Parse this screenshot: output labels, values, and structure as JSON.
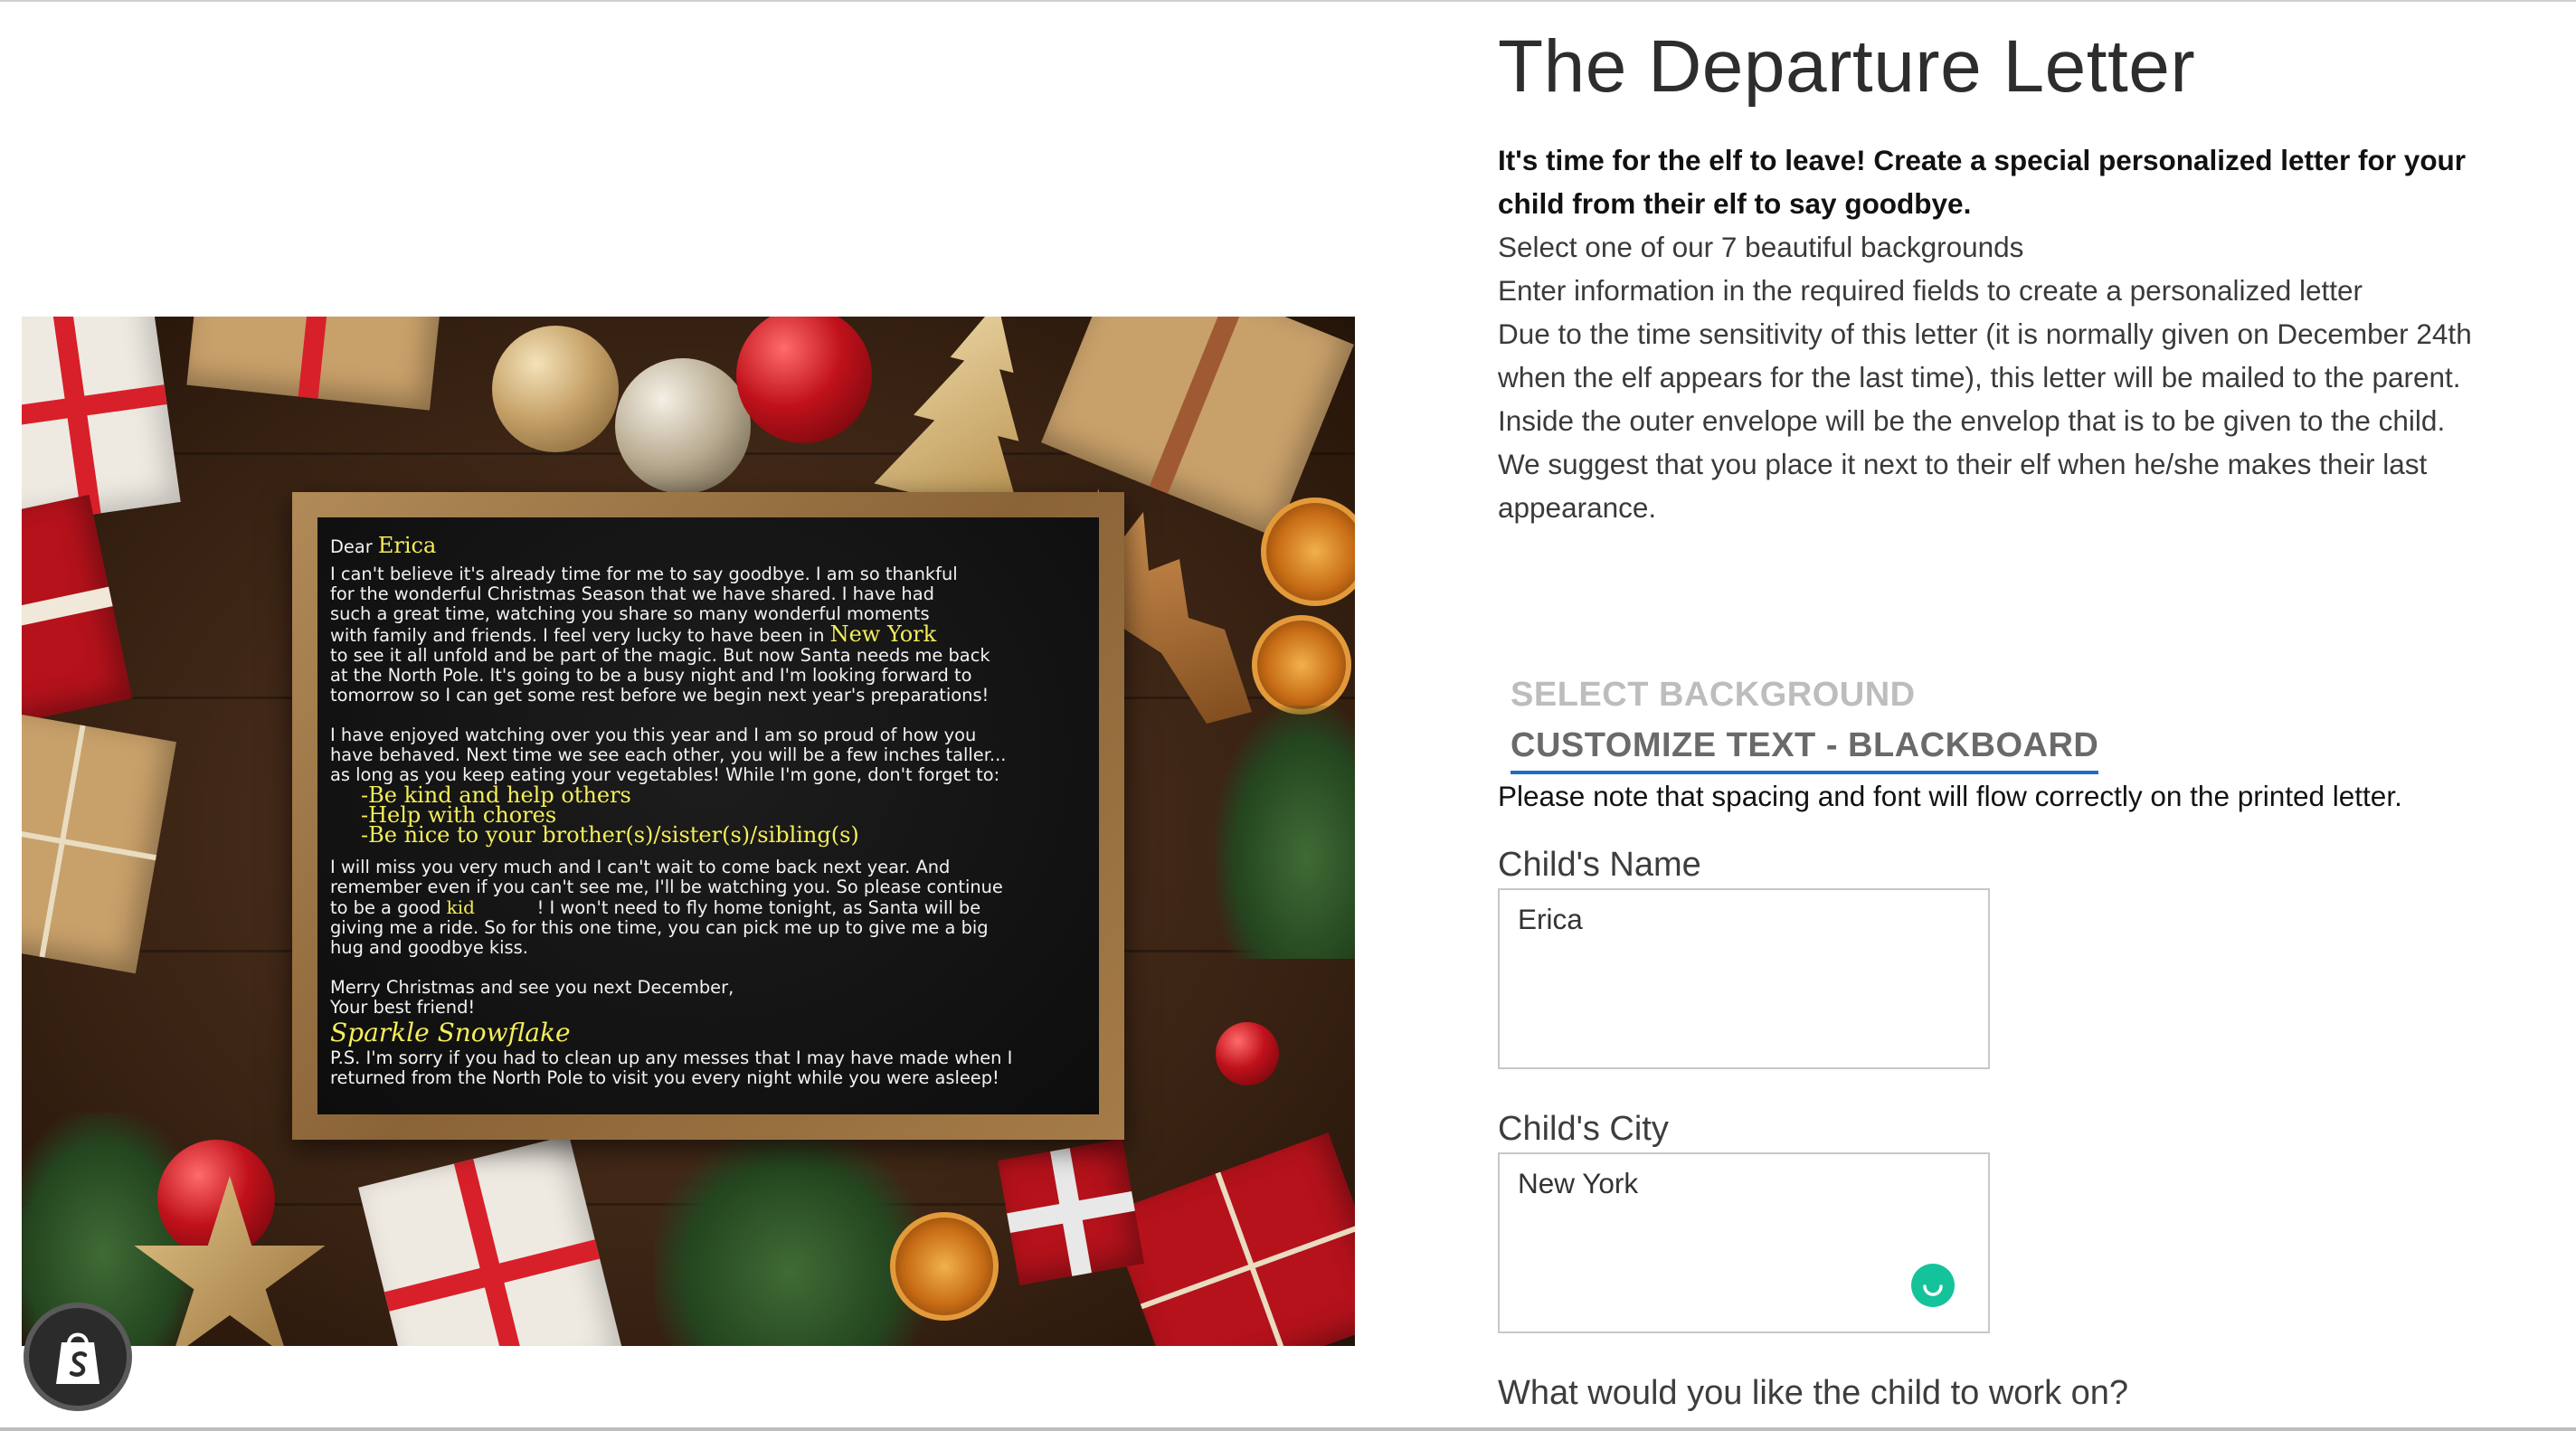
{
  "product": {
    "title": "The Departure Letter",
    "description_lead": "It's time for the elf to leave! Create a special personalized letter for your child from their elf to say goodbye.",
    "description_lines": [
      "Select one of our 7 beautiful backgrounds",
      "Enter information in the required fields to create a personalized letter",
      "Due to the time sensitivity of this letter (it is normally given on December 24th when the elf appears for the last time), this letter will be mailed to the parent. Inside the outer envelope will be the envelop that is to be given to the child. We suggest that you place it next to their elf when he/she makes their last appearance."
    ]
  },
  "tabs": {
    "select_background": "SELECT BACKGROUND",
    "customize_text": "CUSTOMIZE TEXT - BLACKBOARD"
  },
  "note": "Please note that spacing and font will flow correctly on the printed letter.",
  "form": {
    "child_name_label": "Child's Name",
    "child_name_value": "Erica",
    "child_city_label": "Child's City",
    "child_city_value": "New York",
    "work_on_label": "What would you like the child to work on?"
  },
  "letter": {
    "dear": "Dear",
    "name": "Erica",
    "p1_l1": "I can't believe it's already time for me to say goodbye. I am so thankful",
    "p1_l2": "for the wonderful Christmas Season that we have shared. I have had",
    "p1_l3": "such a great time, watching you share so many wonderful moments",
    "p1_l4": "with family and friends. I feel very lucky to have been in",
    "city": "New York",
    "p1_l5": "to see it all unfold and be part of the magic. But now Santa needs me back",
    "p1_l6": "at the North Pole. It's going to be a busy night and I'm looking forward to",
    "p1_l7": "tomorrow so I can get some rest before we begin next year's preparations!",
    "p2_l1": "I have enjoyed watching over you this year and I am so proud of how you",
    "p2_l2": "have behaved. Next time we see each other, you will be a few inches taller...",
    "p2_l3": "as long as you keep eating your vegetables! While I'm gone, don't forget to:",
    "list_1": "-Be kind and help others",
    "list_2": "-Help with chores",
    "list_3": "-Be nice to your brother(s)/sister(s)/sibling(s)",
    "p3_l1": "I will miss you very much and I can't wait to come back next year. And",
    "p3_l2": "remember even if you can't see me, I'll be watching you. So please continue",
    "p3_l3a": "to be a good",
    "kid": "kid",
    "p3_l3b": "! I won't need to fly home tonight, as Santa will be",
    "p3_l4": "giving me a ride. So for this one time, you can pick me up to give me a big",
    "p3_l5": "hug and goodbye kiss.",
    "closing_1": "Merry Christmas and see you next December,",
    "closing_2": "Your best friend!",
    "signature": "Sparkle Snowflake",
    "ps_1": "P.S. I'm sorry if you had to clean up any messes that I may have made when I",
    "ps_2": "returned from the North Pole to visit you every night while you were asleep!"
  },
  "icons": {
    "shopify": "shopify-bag-icon",
    "grammarly": "grammarly-icon"
  },
  "colors": {
    "tab_underline": "#1f6dc2",
    "letter_highlight": "#f4ee5a",
    "grammarly": "#15c39a"
  }
}
